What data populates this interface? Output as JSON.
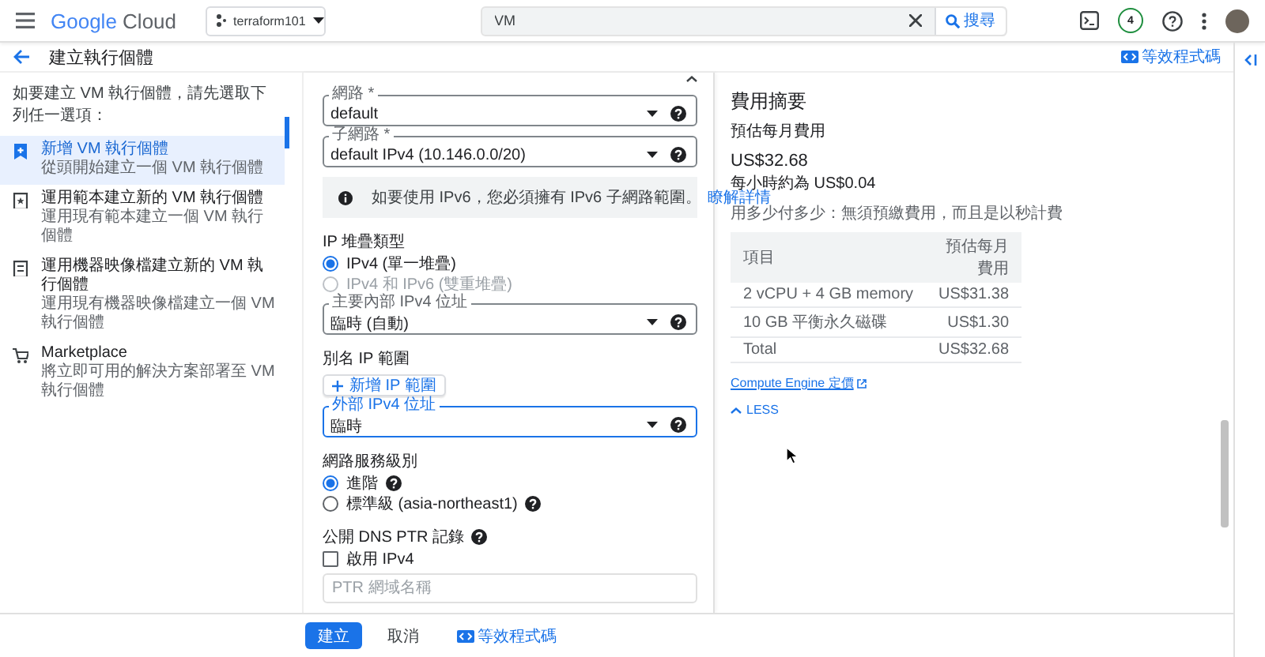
{
  "header": {
    "brand": "Google",
    "product": "Cloud",
    "project": "terraform101",
    "search": {
      "value": "VM"
    },
    "search_button": "搜尋",
    "notifications": "4"
  },
  "page": {
    "title": "建立執行個體",
    "code_link": "等效程式碼"
  },
  "sidebar": {
    "intro": "如要建立 VM 執行個體，請先選取下列任一選項：",
    "items": [
      {
        "kind": "new",
        "title": "新增 VM 執行個體",
        "subtitle": "從頭開始建立一個 VM 執行個體",
        "selected": true
      },
      {
        "kind": "template",
        "title": "運用範本建立新的 VM 執行個體",
        "subtitle": "運用現有範本建立一個 VM 執行個體",
        "selected": false
      },
      {
        "kind": "image",
        "title": "運用機器映像檔建立新的 VM 執行個體",
        "subtitle": "運用現有機器映像檔建立一個 VM 執行個體",
        "selected": false
      },
      {
        "kind": "marketplace",
        "title": "Marketplace",
        "subtitle": "將立即可用的解決方案部署至 VM 執行個體",
        "selected": false
      }
    ]
  },
  "form": {
    "rows": [
      {
        "kind": "select",
        "label": "網路 *",
        "value": "default",
        "focused": false,
        "help": true
      },
      {
        "kind": "select",
        "label": "子網路 *",
        "value": "default IPv4 (10.146.0.0/20)",
        "focused": false,
        "help": true
      },
      {
        "kind": "info",
        "text": "如要使用 IPv6，您必須擁有 IPv6 子網路範圍。",
        "link": "瞭解詳情"
      },
      {
        "kind": "heading",
        "text": "IP 堆疊類型"
      },
      {
        "kind": "radio",
        "label": "IPv4 (單一堆疊)",
        "selected": true,
        "disabled": false
      },
      {
        "kind": "radio",
        "label": "IPv4 和 IPv6 (雙重堆疊)",
        "selected": false,
        "disabled": true
      },
      {
        "kind": "select",
        "label": "主要內部 IPv4 位址",
        "value": "臨時 (自動)",
        "focused": false,
        "help": true
      },
      {
        "kind": "heading",
        "text": "別名 IP 範圍"
      },
      {
        "kind": "button",
        "label": "新增 IP 範圍"
      },
      {
        "kind": "select",
        "label": "外部 IPv4 位址",
        "value": "臨時",
        "focused": true,
        "help": true
      },
      {
        "kind": "heading",
        "text": "網路服務級別"
      },
      {
        "kind": "radio",
        "label": "進階",
        "selected": true,
        "disabled": false,
        "help": true
      },
      {
        "kind": "radio",
        "label": "標準級 (asia-northeast1)",
        "selected": false,
        "disabled": false,
        "help": true
      },
      {
        "kind": "heading",
        "text": "公開 DNS PTR 記錄",
        "help": true
      },
      {
        "kind": "checkbox",
        "label": "啟用 IPv4",
        "checked": false
      },
      {
        "kind": "input",
        "placeholder": "PTR 網域名稱"
      }
    ]
  },
  "summary": {
    "title": "費用摘要",
    "label": "預估每月費用",
    "amount": "US$32.68",
    "hourly": "每小時約為 US$0.04",
    "note": "用多少付多少：無須預繳費用，而且是以秒計費",
    "table": {
      "columns": [
        "項目",
        "預估每月費用"
      ],
      "rows": [
        [
          "2 vCPU + 4 GB memory",
          "US$31.38"
        ],
        [
          "10 GB 平衡永久磁碟",
          "US$1.30"
        ],
        [
          "Total",
          "US$32.68"
        ]
      ]
    },
    "link": "Compute Engine 定價",
    "toggle": "LESS"
  },
  "footer": {
    "buttons": [
      {
        "kind": "primary",
        "label": "建立"
      },
      {
        "kind": "text",
        "label": "取消"
      },
      {
        "kind": "code",
        "label": "等效程式碼"
      }
    ]
  }
}
